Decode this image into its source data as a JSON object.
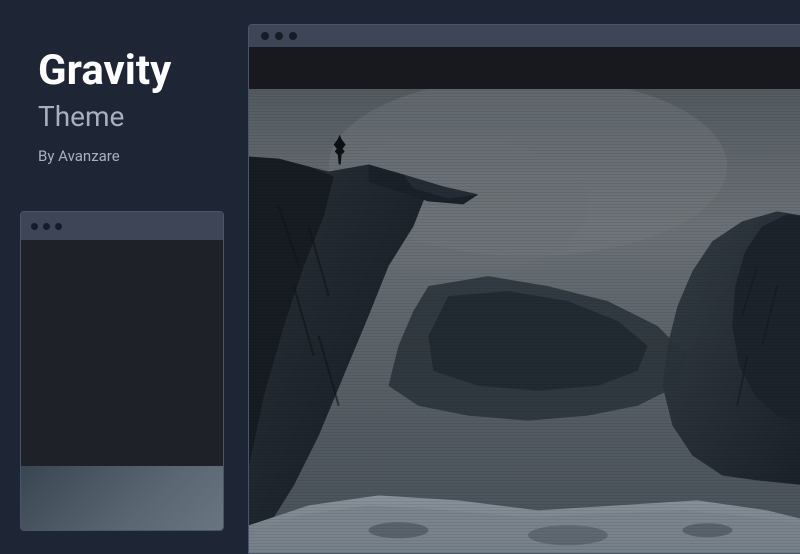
{
  "sidebar": {
    "title": "Gravity",
    "subtitle": "Theme",
    "author_prefix": "By ",
    "author_name": "Avanzare"
  }
}
